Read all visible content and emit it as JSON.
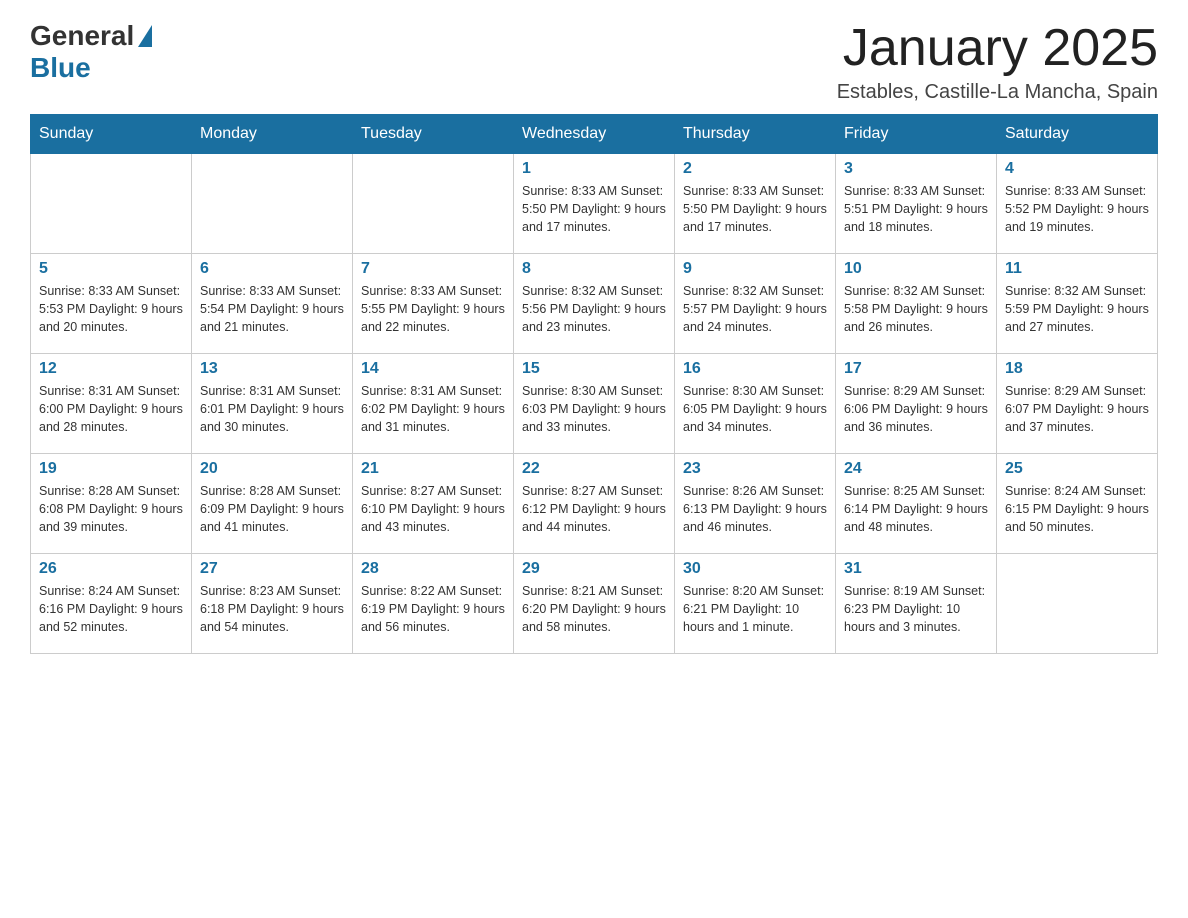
{
  "logo": {
    "general": "General",
    "blue": "Blue"
  },
  "title": "January 2025",
  "subtitle": "Estables, Castille-La Mancha, Spain",
  "days_of_week": [
    "Sunday",
    "Monday",
    "Tuesday",
    "Wednesday",
    "Thursday",
    "Friday",
    "Saturday"
  ],
  "weeks": [
    [
      {
        "day": "",
        "info": ""
      },
      {
        "day": "",
        "info": ""
      },
      {
        "day": "",
        "info": ""
      },
      {
        "day": "1",
        "info": "Sunrise: 8:33 AM\nSunset: 5:50 PM\nDaylight: 9 hours\nand 17 minutes."
      },
      {
        "day": "2",
        "info": "Sunrise: 8:33 AM\nSunset: 5:50 PM\nDaylight: 9 hours\nand 17 minutes."
      },
      {
        "day": "3",
        "info": "Sunrise: 8:33 AM\nSunset: 5:51 PM\nDaylight: 9 hours\nand 18 minutes."
      },
      {
        "day": "4",
        "info": "Sunrise: 8:33 AM\nSunset: 5:52 PM\nDaylight: 9 hours\nand 19 minutes."
      }
    ],
    [
      {
        "day": "5",
        "info": "Sunrise: 8:33 AM\nSunset: 5:53 PM\nDaylight: 9 hours\nand 20 minutes."
      },
      {
        "day": "6",
        "info": "Sunrise: 8:33 AM\nSunset: 5:54 PM\nDaylight: 9 hours\nand 21 minutes."
      },
      {
        "day": "7",
        "info": "Sunrise: 8:33 AM\nSunset: 5:55 PM\nDaylight: 9 hours\nand 22 minutes."
      },
      {
        "day": "8",
        "info": "Sunrise: 8:32 AM\nSunset: 5:56 PM\nDaylight: 9 hours\nand 23 minutes."
      },
      {
        "day": "9",
        "info": "Sunrise: 8:32 AM\nSunset: 5:57 PM\nDaylight: 9 hours\nand 24 minutes."
      },
      {
        "day": "10",
        "info": "Sunrise: 8:32 AM\nSunset: 5:58 PM\nDaylight: 9 hours\nand 26 minutes."
      },
      {
        "day": "11",
        "info": "Sunrise: 8:32 AM\nSunset: 5:59 PM\nDaylight: 9 hours\nand 27 minutes."
      }
    ],
    [
      {
        "day": "12",
        "info": "Sunrise: 8:31 AM\nSunset: 6:00 PM\nDaylight: 9 hours\nand 28 minutes."
      },
      {
        "day": "13",
        "info": "Sunrise: 8:31 AM\nSunset: 6:01 PM\nDaylight: 9 hours\nand 30 minutes."
      },
      {
        "day": "14",
        "info": "Sunrise: 8:31 AM\nSunset: 6:02 PM\nDaylight: 9 hours\nand 31 minutes."
      },
      {
        "day": "15",
        "info": "Sunrise: 8:30 AM\nSunset: 6:03 PM\nDaylight: 9 hours\nand 33 minutes."
      },
      {
        "day": "16",
        "info": "Sunrise: 8:30 AM\nSunset: 6:05 PM\nDaylight: 9 hours\nand 34 minutes."
      },
      {
        "day": "17",
        "info": "Sunrise: 8:29 AM\nSunset: 6:06 PM\nDaylight: 9 hours\nand 36 minutes."
      },
      {
        "day": "18",
        "info": "Sunrise: 8:29 AM\nSunset: 6:07 PM\nDaylight: 9 hours\nand 37 minutes."
      }
    ],
    [
      {
        "day": "19",
        "info": "Sunrise: 8:28 AM\nSunset: 6:08 PM\nDaylight: 9 hours\nand 39 minutes."
      },
      {
        "day": "20",
        "info": "Sunrise: 8:28 AM\nSunset: 6:09 PM\nDaylight: 9 hours\nand 41 minutes."
      },
      {
        "day": "21",
        "info": "Sunrise: 8:27 AM\nSunset: 6:10 PM\nDaylight: 9 hours\nand 43 minutes."
      },
      {
        "day": "22",
        "info": "Sunrise: 8:27 AM\nSunset: 6:12 PM\nDaylight: 9 hours\nand 44 minutes."
      },
      {
        "day": "23",
        "info": "Sunrise: 8:26 AM\nSunset: 6:13 PM\nDaylight: 9 hours\nand 46 minutes."
      },
      {
        "day": "24",
        "info": "Sunrise: 8:25 AM\nSunset: 6:14 PM\nDaylight: 9 hours\nand 48 minutes."
      },
      {
        "day": "25",
        "info": "Sunrise: 8:24 AM\nSunset: 6:15 PM\nDaylight: 9 hours\nand 50 minutes."
      }
    ],
    [
      {
        "day": "26",
        "info": "Sunrise: 8:24 AM\nSunset: 6:16 PM\nDaylight: 9 hours\nand 52 minutes."
      },
      {
        "day": "27",
        "info": "Sunrise: 8:23 AM\nSunset: 6:18 PM\nDaylight: 9 hours\nand 54 minutes."
      },
      {
        "day": "28",
        "info": "Sunrise: 8:22 AM\nSunset: 6:19 PM\nDaylight: 9 hours\nand 56 minutes."
      },
      {
        "day": "29",
        "info": "Sunrise: 8:21 AM\nSunset: 6:20 PM\nDaylight: 9 hours\nand 58 minutes."
      },
      {
        "day": "30",
        "info": "Sunrise: 8:20 AM\nSunset: 6:21 PM\nDaylight: 10 hours\nand 1 minute."
      },
      {
        "day": "31",
        "info": "Sunrise: 8:19 AM\nSunset: 6:23 PM\nDaylight: 10 hours\nand 3 minutes."
      },
      {
        "day": "",
        "info": ""
      }
    ]
  ]
}
